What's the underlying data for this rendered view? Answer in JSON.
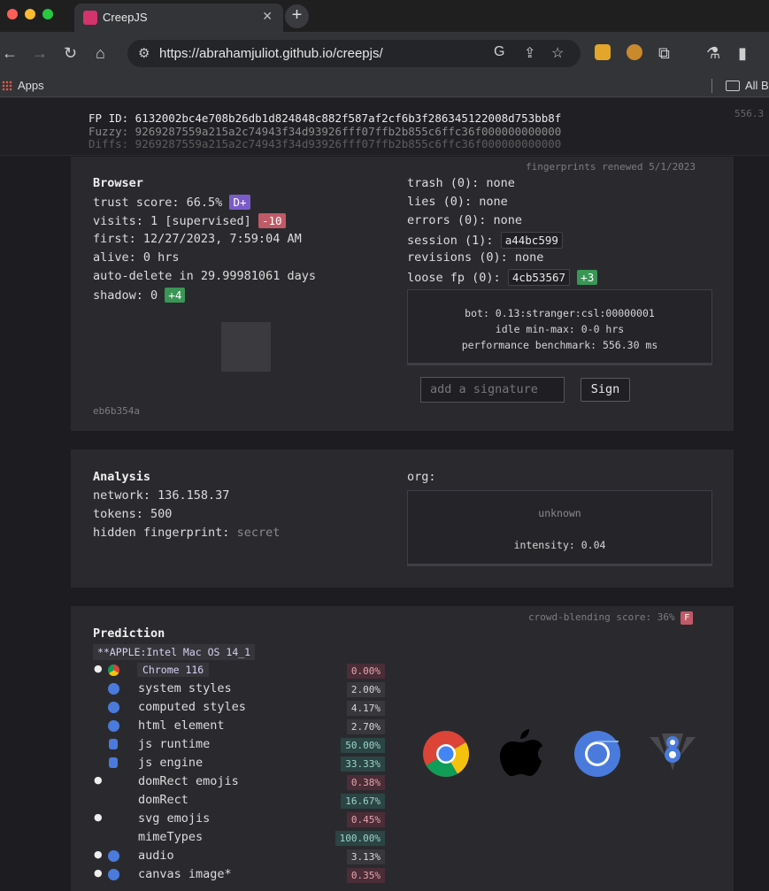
{
  "browser_chrome": {
    "tab_title": "CreepJS",
    "url": "https://abrahamjuliot.github.io/creepjs/",
    "bookmarks": {
      "apps": "Apps",
      "all": "All B"
    }
  },
  "fingerprint": {
    "fp_id": "FP ID: 6132002bc4e708b26db1d824848c882f587af2cf6b3f286345122008d753bb8f",
    "fuzzy": "Fuzzy: 9269287559a215a2c74943f34d93926fff07ffb2b855c6ffc36f000000000000",
    "diffs": "Diffs: 9269287559a215a2c74943f34d93926fff07ffb2b855c6ffc36f000000000000",
    "side_value": "556.3"
  },
  "browser_panel": {
    "renewed": "fingerprints renewed 5/1/2023",
    "title": "Browser",
    "trust_label": "trust score: 66.5%",
    "trust_grade": "D+",
    "visits_label": "visits: 1 [supervised]",
    "visits_delta": "-10",
    "first": "first: 12/27/2023, 7:59:04 AM",
    "alive": "alive: 0 hrs",
    "auto_delete": "auto-delete in 29.99981061 days",
    "shadow_label": "shadow: 0",
    "shadow_delta": "+4",
    "hash": "eb6b354a",
    "trash": "trash (0): none",
    "lies": "lies (0): none",
    "errors": "errors (0): none",
    "session_label": "session (1):",
    "session_value": "a44bc599",
    "revisions": "revisions (0): none",
    "loose_label": "loose fp (0):",
    "loose_value": "4cb53567",
    "loose_delta": "+3",
    "bot": "bot: 0.13:stranger:csl:00000001",
    "idle": "idle min-max: 0-0 hrs",
    "benchmark": "performance benchmark: 556.30 ms",
    "signature_placeholder": "add a signature",
    "sign_button": "Sign"
  },
  "analysis_panel": {
    "title": "Analysis",
    "network": "network: 136.158.37",
    "tokens": "tokens: 500",
    "hidden_label": "hidden fingerprint:",
    "hidden_value": "secret",
    "org": "org:",
    "unknown": "unknown",
    "intensity": "intensity: 0.04"
  },
  "prediction_panel": {
    "crowd_label": "crowd-blending score: 36%",
    "crowd_grade": "F",
    "title": "Prediction",
    "os_tag": "**APPLE:Intel Mac OS 14_1",
    "browser_tag": "Chrome 116",
    "rows": [
      {
        "label": "",
        "pct": "0.00%"
      },
      {
        "label": "system styles",
        "pct": "2.00%"
      },
      {
        "label": "computed styles",
        "pct": "4.17%"
      },
      {
        "label": "html element",
        "pct": "2.70%"
      },
      {
        "label": "js runtime",
        "pct": "50.00%"
      },
      {
        "label": "js engine",
        "pct": "33.33%"
      },
      {
        "label": "domRect emojis",
        "pct": "0.38%"
      },
      {
        "label": "domRect",
        "pct": "16.67%"
      },
      {
        "label": "svg emojis",
        "pct": "0.45%"
      },
      {
        "label": "mimeTypes",
        "pct": "100.00%"
      },
      {
        "label": "audio",
        "pct": "3.13%"
      },
      {
        "label": "canvas image*",
        "pct": "0.35%"
      }
    ]
  }
}
